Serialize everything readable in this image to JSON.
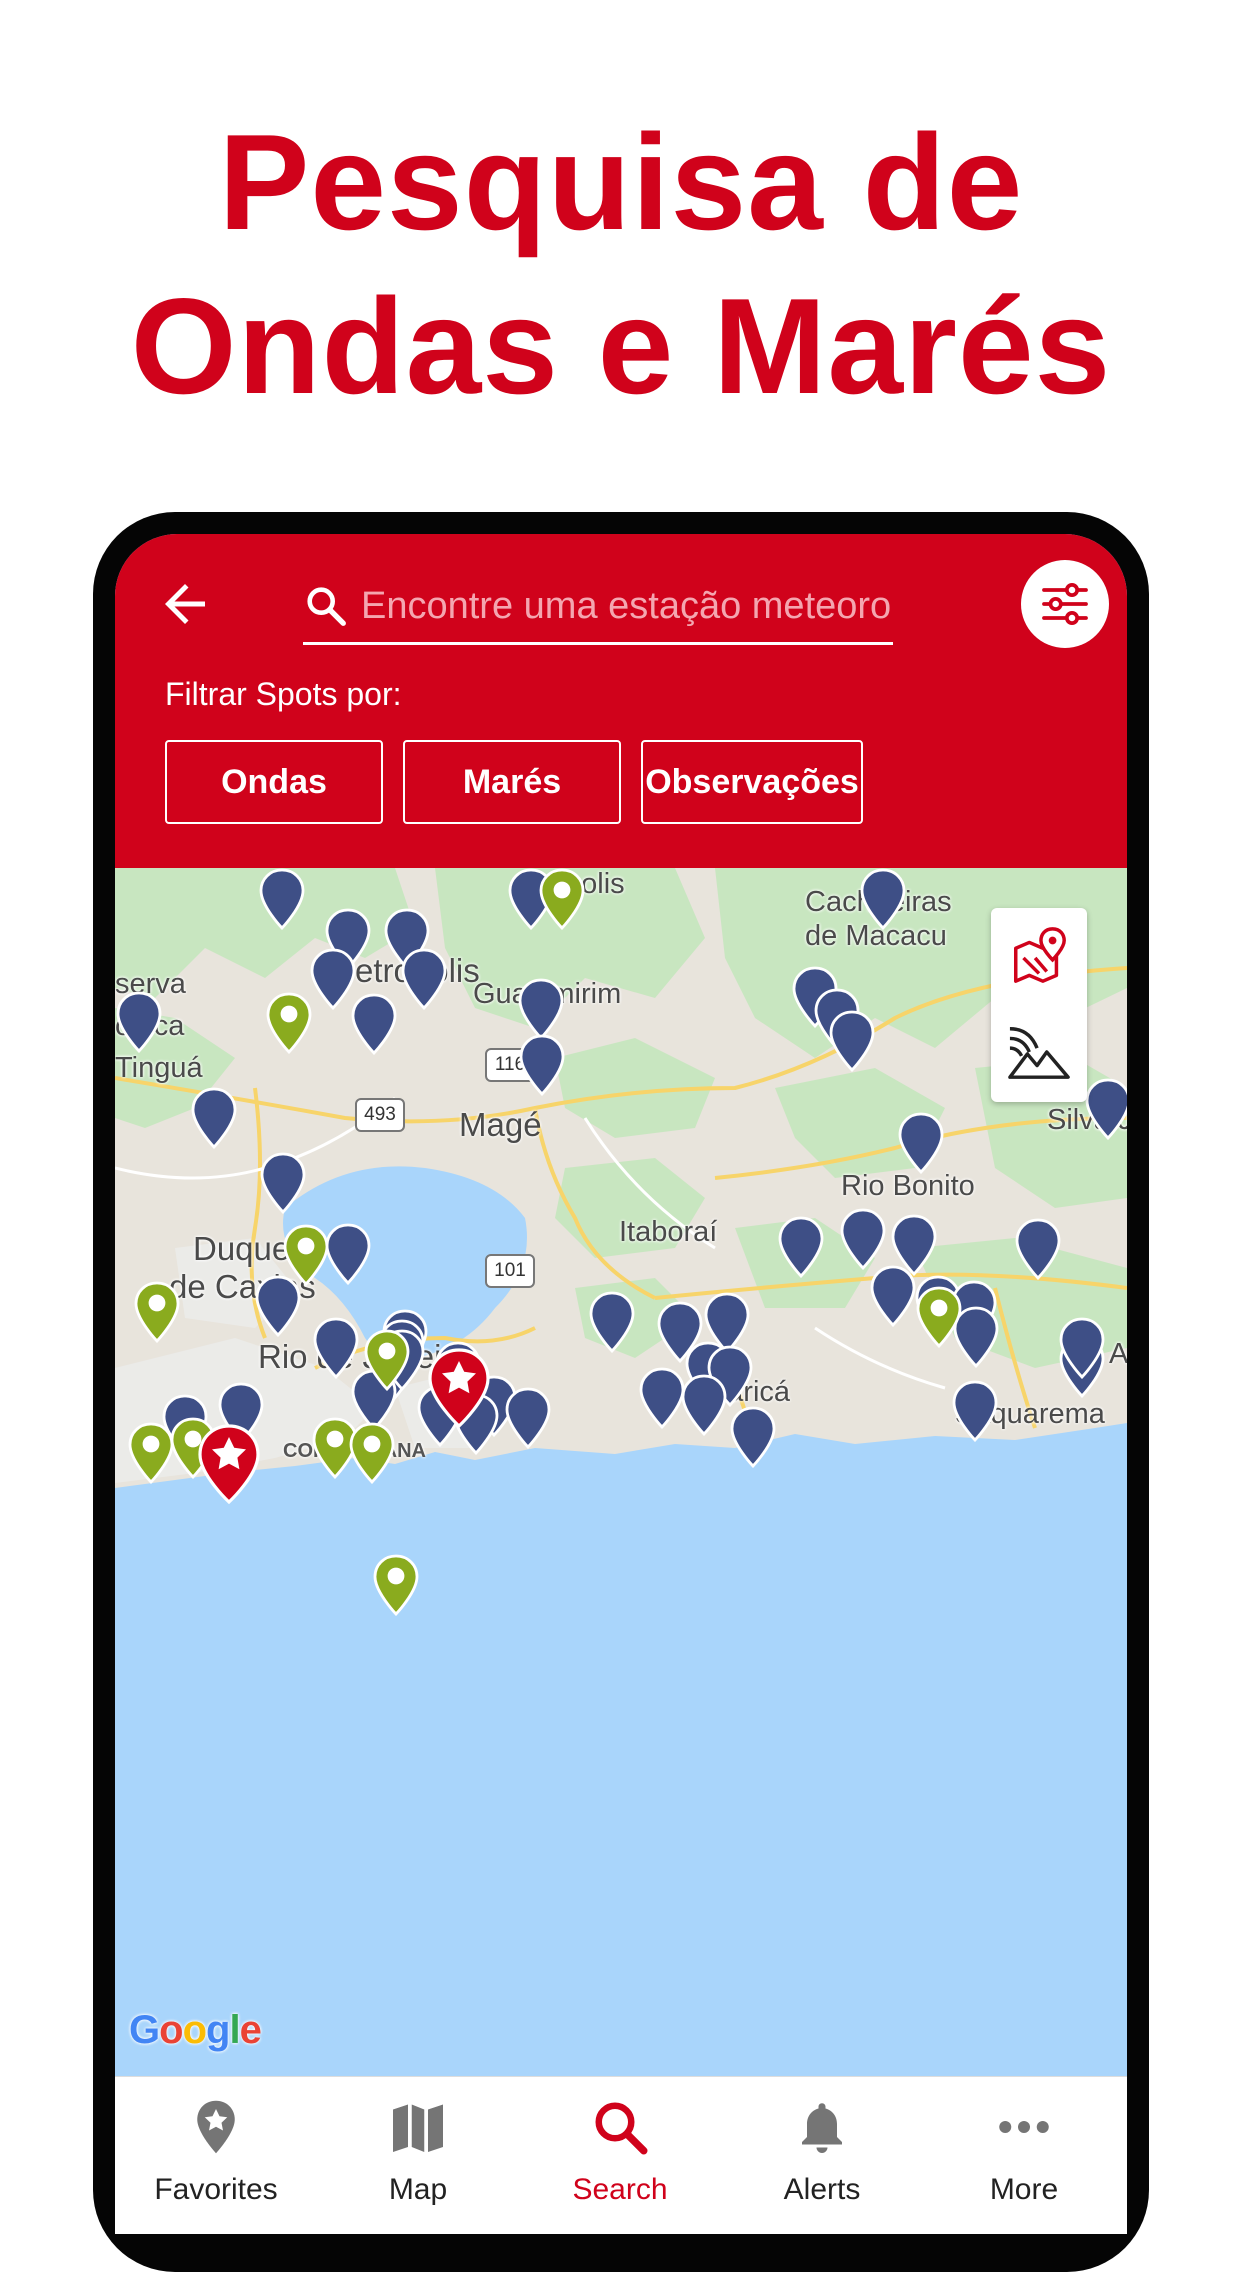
{
  "headline": {
    "line1": "Pesquisa de",
    "line2": "Ondas e Marés"
  },
  "colors": {
    "brand_red": "#d0021b",
    "pin_blue": "#3e4f86",
    "pin_green": "#8aab1e",
    "water": "#a9d5fb",
    "land": "#e8e4dc",
    "park": "#c8e6c0"
  },
  "header": {
    "back_icon": "arrow-left-icon",
    "search": {
      "placeholder": "Encontre uma estação meteorológica",
      "value": "",
      "icon": "search-icon"
    },
    "filter_icon": "sliders-icon",
    "filter_label": "Filtrar Spots por:",
    "chips": [
      {
        "label": "Ondas"
      },
      {
        "label": "Marés"
      },
      {
        "label": "Observações"
      }
    ]
  },
  "map": {
    "labels": {
      "polis": "polis",
      "cachoeiras": "Cachoeiras",
      "de_macacu": "de Macacu",
      "petropolis": "Petrópolis",
      "reserva": "serva",
      "biologica": "ógica",
      "tingua": "Tinguá",
      "guapimirim": "Guapimirim",
      "mage": "Magé",
      "silva_jardim": "Silva J",
      "rio_bonito": "Rio Bonito",
      "duque": "Duque",
      "de_caxias": "de Caxias",
      "itaborai": "Itaboraí",
      "rio": "Rio de Janeiro",
      "marica": "Maricá",
      "saquarema": "Saquarema",
      "a": "A",
      "copacabana": "COPACABANA"
    },
    "shields": [
      "493",
      "101",
      "116"
    ],
    "tools": [
      "map-pin-icon",
      "radar-terrain-icon"
    ],
    "attribution": "Google"
  },
  "bottom_nav": {
    "items": [
      {
        "label": "Favorites",
        "icon": "favorite-pin-icon"
      },
      {
        "label": "Map",
        "icon": "map-icon"
      },
      {
        "label": "Search",
        "icon": "search-icon",
        "active": true
      },
      {
        "label": "Alerts",
        "icon": "bell-icon"
      },
      {
        "label": "More",
        "icon": "more-dots-icon"
      }
    ]
  }
}
